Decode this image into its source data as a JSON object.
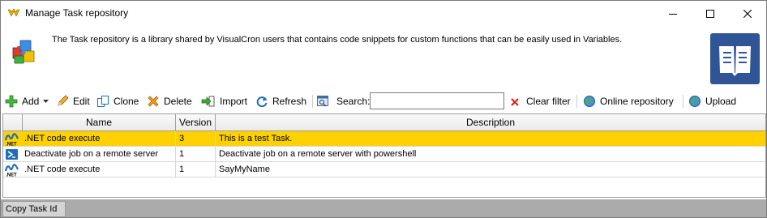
{
  "window": {
    "title": "Manage Task repository"
  },
  "header": {
    "description": "The Task repository is a library shared by VisualCron users that contains code snippets for custom functions that can be easily used in Variables."
  },
  "toolbar": {
    "add": "Add",
    "edit": "Edit",
    "clone": "Clone",
    "delete": "Delete",
    "import": "Import",
    "refresh": "Refresh",
    "search_label": "Search:",
    "search_value": "",
    "clear_filter": "Clear filter",
    "online_repository": "Online repository",
    "upload": "Upload"
  },
  "grid": {
    "columns": {
      "name": "Name",
      "version": "Version",
      "description": "Description"
    },
    "rows": [
      {
        "icon": "dotnet-icon",
        "name": ".NET code execute",
        "version": "3",
        "description": "This is a test Task.",
        "selected": true
      },
      {
        "icon": "powershell-icon",
        "name": "Deactivate job on a remote server",
        "version": "1",
        "description": "Deactivate job on a remote server with powershell",
        "selected": false
      },
      {
        "icon": "dotnet-icon",
        "name": ".NET code execute",
        "version": "1",
        "description": "SayMyName",
        "selected": false
      }
    ]
  },
  "statusbar": {
    "copy_task_id": "Copy Task Id"
  },
  "colors": {
    "selection": "#fdd102",
    "book_icon": "#2f5597",
    "statusbar": "#ababab"
  }
}
